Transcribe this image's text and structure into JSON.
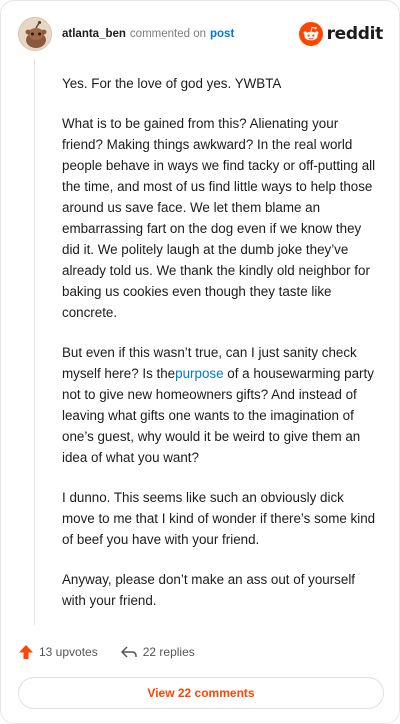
{
  "comment": {
    "username": "atlanta_ben",
    "commented_text": "commented on",
    "post_link": "post",
    "paragraphs": {
      "p1": "Yes. For the love of god yes. YWBTA",
      "p2": "What is to be gained from this? Alienating your friend? Making things awkward? In the real world people behave in ways we find tacky or off-putting all the time, and most of us find little ways to help those around us save face. We let them blame an embarrassing fart on the dog even if we know they did it. We politely laugh at the dumb joke they’ve already told us. We thank the kindly old neighbor for baking us cookies even though they taste like concrete.",
      "p3_before": "But even if this wasn’t true, can I just sanity check myself here? Is the",
      "p3_link": "purpose",
      "p3_after": " of a housewarming party not to give new homeowners gifts? And instead of leaving what gifts one wants to the imagination of one’s guest, why would it be weird to give them an idea of what you want?",
      "p4": "I dunno. This seems like such an obviously dick move to me that I kind of wonder if there’s some kind of beef you have with your friend.",
      "p5": "Anyway, please don’t make an ass out of yourself with your friend."
    },
    "upvotes_label": "13 upvotes",
    "replies_label": "22 replies",
    "view_comments_label": "View 22 comments"
  },
  "brand": {
    "wordmark": "reddit",
    "color": "#ff4500"
  },
  "icons": {
    "avatar": "snoo-avatar",
    "brand": "reddit-logo-icon",
    "upvote": "upvote-arrow-icon",
    "reply": "reply-arrow-icon"
  },
  "colors": {
    "link": "#0079d3",
    "accent": "#ff4500",
    "text": "#1c1c1c",
    "muted": "#7c7c7c"
  }
}
